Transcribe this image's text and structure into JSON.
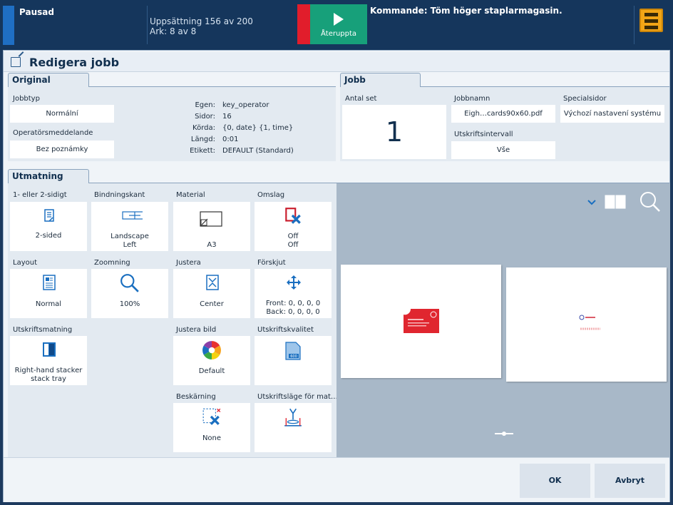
{
  "topbar": {
    "status": "Pausad",
    "counter_line1": "Uppsättning 156 av 200",
    "counter_line2": "Ark: 8 av 8",
    "resume_label": "Återuppta",
    "command": "Kommande: Töm höger staplarmagasin.",
    "colors": {
      "status_strip": "#1f6fc4",
      "red_block": "#e11d2b",
      "resume_button": "#17a07a",
      "stacker_button": "#f2a516"
    }
  },
  "dialog": {
    "title": "Redigera jobb",
    "original": {
      "tab": "Original",
      "jobtype_label": "Jobbtyp",
      "jobtype_value": "Normální",
      "operator_msg_label": "Operatörsmeddelande",
      "operator_msg_value": "Bez poznámky",
      "info": [
        {
          "k": "Egen:",
          "v": "key_operator"
        },
        {
          "k": "Sidor:",
          "v": "16"
        },
        {
          "k": "Körda:",
          "v": "{0, date} {1, time}"
        },
        {
          "k": "Längd:",
          "v": "0:01"
        },
        {
          "k": "Etikett:",
          "v": "DEFAULT (Standard)"
        }
      ]
    },
    "jobb": {
      "tab": "Jobb",
      "sets_label": "Antal set",
      "sets_value": "1",
      "jobname_label": "Jobbnamn",
      "jobname_value": "Eigh…cards90x60.pdf",
      "range_label": "Utskriftsintervall",
      "range_value": "Vše",
      "special_label": "Specialsidor",
      "special_value": "Výchozí nastavení systému"
    },
    "output": {
      "tab": "Utmatning",
      "tiles": [
        {
          "label": "1- eller 2-sidigt",
          "value": "2-sided",
          "icon": "duplex-icon"
        },
        {
          "label": "Bindningskant",
          "value": "Landscape\nLeft",
          "icon": "binding-edge-icon"
        },
        {
          "label": "Material",
          "value": "A3",
          "icon": "media-icon"
        },
        {
          "label": "Omslag",
          "value": "Off\nOff",
          "icon": "cover-off-icon"
        },
        {
          "label": "Layout",
          "value": "Normal",
          "icon": "layout-icon"
        },
        {
          "label": "Zoomning",
          "value": "100%",
          "icon": "zoom-icon"
        },
        {
          "label": "Justera",
          "value": "Center",
          "icon": "align-center-icon"
        },
        {
          "label": "Förskjut",
          "value": "Front: 0, 0, 0, 0\nBack: 0, 0, 0, 0",
          "icon": "shift-icon"
        },
        {
          "label": "Utskriftsmatning",
          "value": "Right-hand stacker\nstack tray",
          "icon": "stacker-tray-icon"
        },
        {
          "label": "Justera bild",
          "value": "Default",
          "icon": "color-wheel-icon"
        },
        {
          "label": "Utskriftskvalitet",
          "value": "",
          "icon": "print-quality-icon"
        },
        {
          "label": "Beskärning",
          "value": "None",
          "icon": "trim-off-icon"
        },
        {
          "label": "Utskriftsläge för mat…",
          "value": "",
          "icon": "print-mode-icon"
        }
      ]
    },
    "buttons": {
      "ok": "OK",
      "cancel": "Avbryt"
    }
  }
}
